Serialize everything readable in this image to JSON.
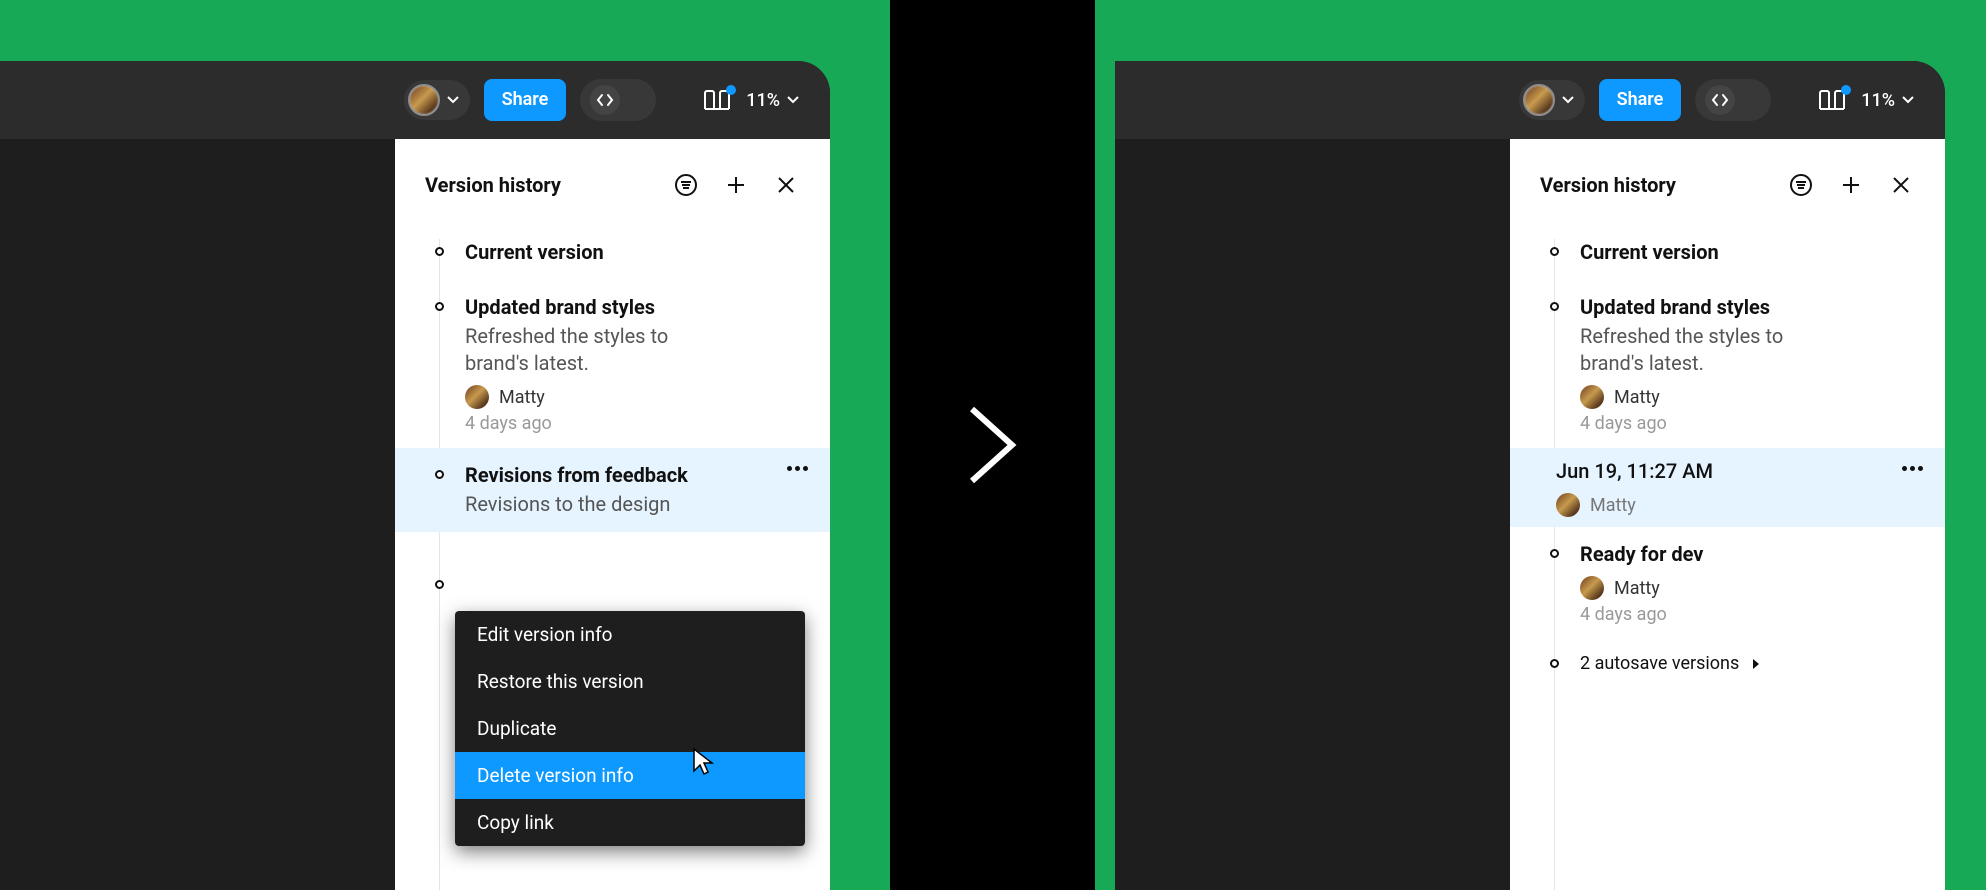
{
  "toolbar": {
    "share_label": "Share",
    "zoom_value": "11%"
  },
  "panel": {
    "title": "Version history"
  },
  "context_menu": {
    "edit": "Edit version info",
    "restore": "Restore this version",
    "duplicate": "Duplicate",
    "delete": "Delete version info",
    "copy_link": "Copy link"
  },
  "left": {
    "items": [
      {
        "title": "Current version"
      },
      {
        "title": "Updated brand styles",
        "desc": "Refreshed the styles to brand's latest.",
        "author": "Matty",
        "ago": "4 days ago"
      },
      {
        "title": "Revisions from feedback",
        "desc": "Revisions to the design"
      }
    ],
    "extra_bullet_title": ""
  },
  "right": {
    "items": [
      {
        "title": "Current version"
      },
      {
        "title": "Updated brand styles",
        "desc": "Refreshed the styles to brand's latest.",
        "author": "Matty",
        "ago": "4 days ago"
      },
      {
        "title": "Jun 19, 11:27 AM",
        "author": "Matty"
      },
      {
        "title": "Ready for dev",
        "author": "Matty",
        "ago": "4 days ago"
      }
    ],
    "autosave": "2 autosave versions"
  }
}
